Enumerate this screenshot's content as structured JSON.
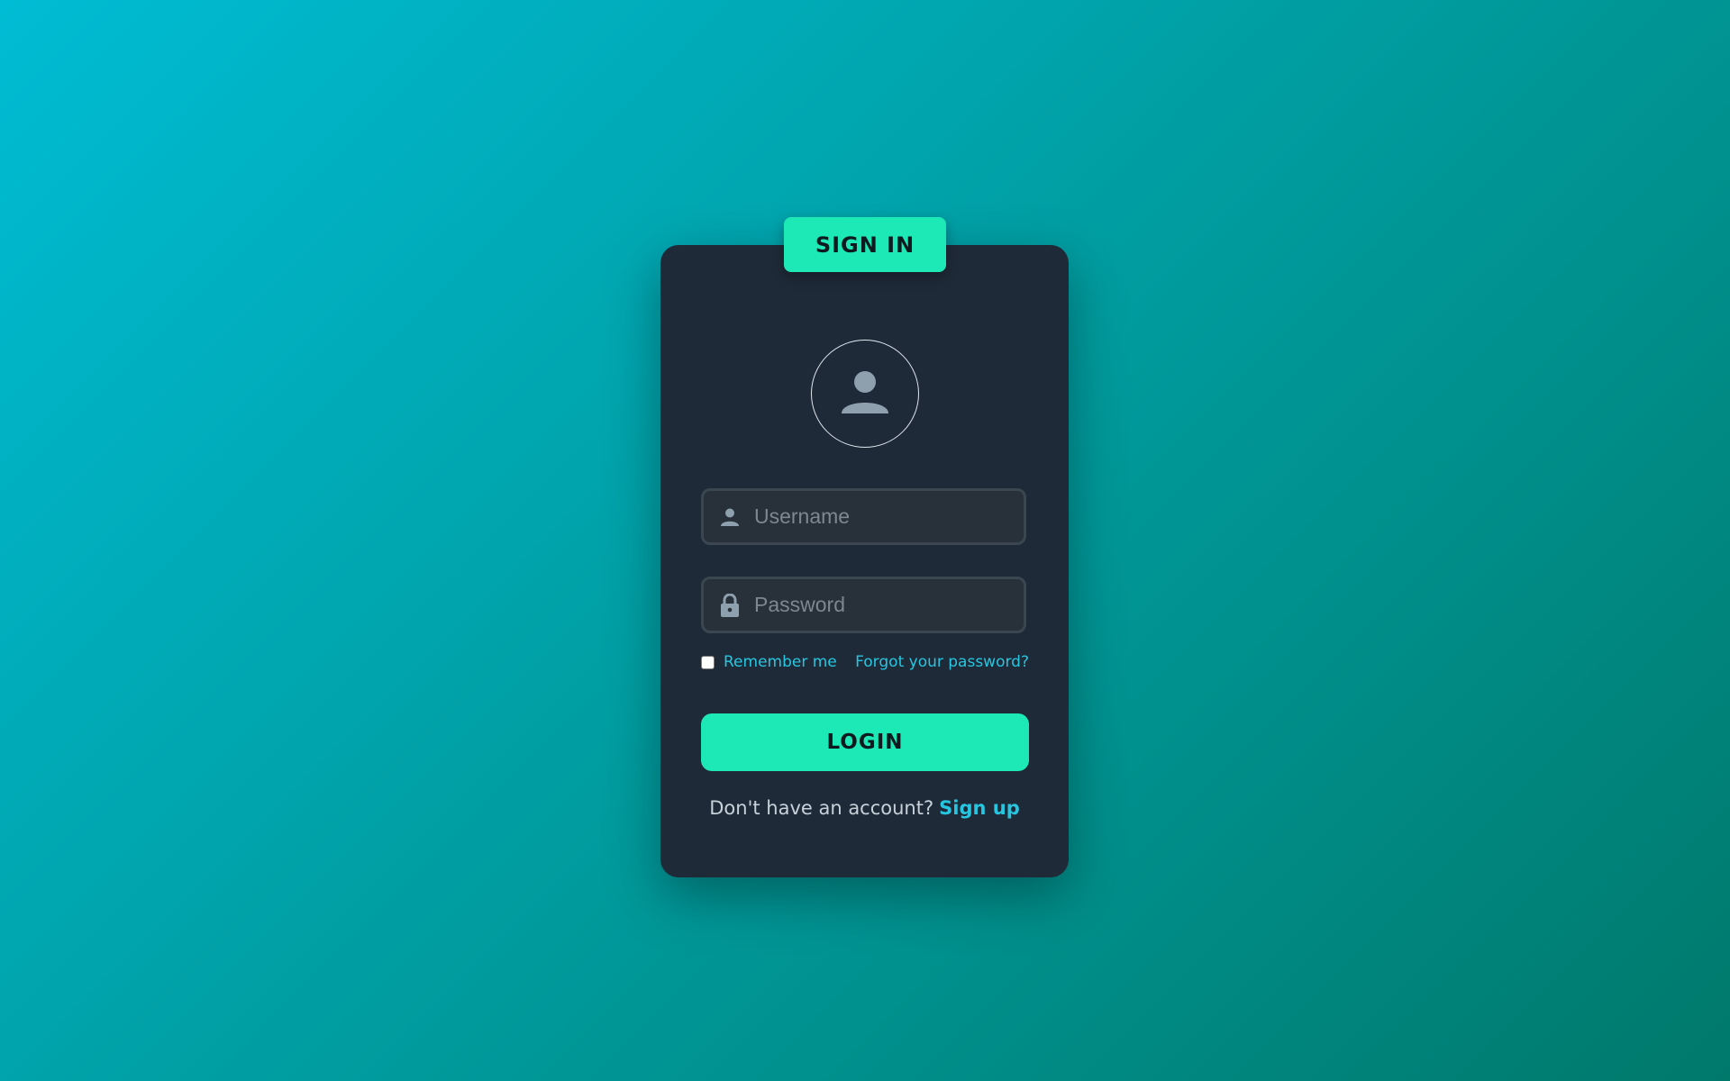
{
  "header": {
    "title": "SIGN IN"
  },
  "avatar": {
    "icon": "user-icon"
  },
  "form": {
    "username": {
      "placeholder": "Username",
      "value": "",
      "icon": "user-icon"
    },
    "password": {
      "placeholder": "Password",
      "value": "",
      "icon": "lock-icon"
    },
    "remember_label": "Remember me",
    "remember_checked": false,
    "forgot_label": "Forgot your password?",
    "login_label": "LOGIN"
  },
  "footer": {
    "prompt": "Don't have an account?",
    "signup_label": "Sign up"
  },
  "colors": {
    "accent": "#1de9b6",
    "link": "#27c6e0",
    "card": "#1f2a38"
  }
}
